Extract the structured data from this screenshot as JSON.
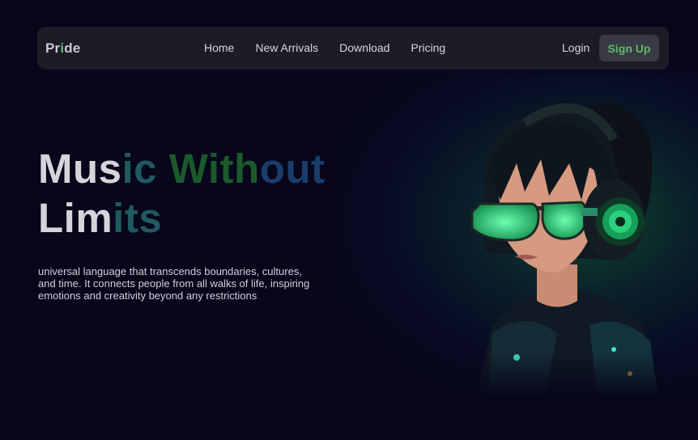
{
  "nav": {
    "logo_prefix": "Pr",
    "logo_accent": "i",
    "logo_suffix": "de",
    "links": [
      "Home",
      "New Arrivals",
      "Download",
      "Pricing"
    ],
    "login_label": "Login",
    "signup_label": "Sign Up"
  },
  "hero": {
    "title_line1_a": "Mus",
    "title_line1_b": "ic ",
    "title_line1_c": "With",
    "title_line1_d": "out",
    "title_line2_a": "Lim",
    "title_line2_b": "its",
    "description": "universal language that transcends boundaries, cultures, and time. It connects people from all walks of life, inspiring emotions and creativity beyond any restrictions"
  },
  "colors": {
    "background": "#07061a",
    "navbar": "#1c1b27",
    "accent_green": "#5fb96b",
    "signup_bg": "#3a3a45"
  }
}
